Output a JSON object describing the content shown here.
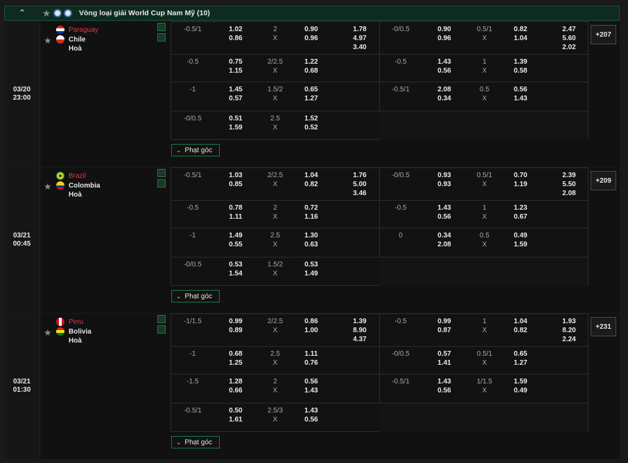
{
  "league": {
    "collapse_icon": "chevron-up-icon",
    "title": "Vòng loại giải World Cup Nam Mỹ (10)"
  },
  "colors": {
    "accent": "#1a7a4a",
    "home_team": "#e03a3a",
    "header_bg": "#0f2a1f"
  },
  "matches": [
    {
      "date": "03/20",
      "time": "23:00",
      "home": "Paraguay",
      "away": "Chile",
      "draw": "Hoà",
      "more": "+207",
      "corner": "Phạt góc",
      "rows": [
        {
          "l": {
            "h": "-0.5/1",
            "a": "1.02",
            "b": "0.86",
            "ou": "2",
            "x": "X",
            "o": "0.90",
            "u": "0.96",
            "m1": "1.78",
            "m2": "4.97",
            "m3": "3.40"
          },
          "r": {
            "h": "-0/0.5",
            "a": "0.90",
            "b": "0.96",
            "ou": "0.5/1",
            "x": "X",
            "o": "0.82",
            "u": "1.04",
            "m1": "2.47",
            "m2": "5.60",
            "m3": "2.02"
          }
        },
        {
          "l": {
            "h": "-0.5",
            "a": "0.75",
            "b": "1.15",
            "ou": "2/2.5",
            "x": "X",
            "o": "1.22",
            "u": "0.68"
          },
          "r": {
            "h": "-0.5",
            "a": "1.43",
            "b": "0.56",
            "ou": "1",
            "x": "X",
            "o": "1.39",
            "u": "0.58"
          }
        },
        {
          "l": {
            "h": "-1",
            "a": "1.45",
            "b": "0.57",
            "ou": "1.5/2",
            "x": "X",
            "o": "0.65",
            "u": "1.27"
          },
          "r": {
            "h": "-0.5/1",
            "a": "2.08",
            "b": "0.34",
            "ou": "0.5",
            "x": "X",
            "o": "0.56",
            "u": "1.43"
          }
        },
        {
          "l": {
            "h": "-0/0.5",
            "a": "0.51",
            "b": "1.59",
            "ou": "2.5",
            "x": "X",
            "o": "1.52",
            "u": "0.52"
          }
        }
      ]
    },
    {
      "date": "03/21",
      "time": "00:45",
      "home": "Brazil",
      "away": "Colombia",
      "draw": "Hoà",
      "more": "+209",
      "corner": "Phạt góc",
      "rows": [
        {
          "l": {
            "h": "-0.5/1",
            "a": "1.03",
            "b": "0.85",
            "ou": "2/2.5",
            "x": "X",
            "o": "1.04",
            "u": "0.82",
            "m1": "1.76",
            "m2": "5.00",
            "m3": "3.46"
          },
          "r": {
            "h": "-0/0.5",
            "a": "0.93",
            "b": "0.93",
            "ou": "0.5/1",
            "x": "X",
            "o": "0.70",
            "u": "1.19",
            "m1": "2.39",
            "m2": "5.50",
            "m3": "2.08"
          }
        },
        {
          "l": {
            "h": "-0.5",
            "a": "0.78",
            "b": "1.11",
            "ou": "2",
            "x": "X",
            "o": "0.72",
            "u": "1.16"
          },
          "r": {
            "h": "-0.5",
            "a": "1.43",
            "b": "0.56",
            "ou": "1",
            "x": "X",
            "o": "1.23",
            "u": "0.67"
          }
        },
        {
          "l": {
            "h": "-1",
            "a": "1.49",
            "b": "0.55",
            "ou": "2.5",
            "x": "X",
            "o": "1.30",
            "u": "0.63"
          },
          "r": {
            "h": "0",
            "a": "0.34",
            "b": "2.08",
            "ou": "0.5",
            "x": "X",
            "o": "0.49",
            "u": "1.59"
          }
        },
        {
          "l": {
            "h": "-0/0.5",
            "a": "0.53",
            "b": "1.54",
            "ou": "1.5/2",
            "x": "X",
            "o": "0.53",
            "u": "1.49"
          }
        }
      ]
    },
    {
      "date": "03/21",
      "time": "01:30",
      "home": "Peru",
      "away": "Bolivia",
      "draw": "Hoà",
      "more": "+231",
      "corner": "Phạt góc",
      "rows": [
        {
          "l": {
            "h": "-1/1.5",
            "a": "0.99",
            "b": "0.89",
            "ou": "2/2.5",
            "x": "X",
            "o": "0.86",
            "u": "1.00",
            "m1": "1.39",
            "m2": "8.90",
            "m3": "4.37"
          },
          "r": {
            "h": "-0.5",
            "a": "0.99",
            "b": "0.87",
            "ou": "1",
            "x": "X",
            "o": "1.04",
            "u": "0.82",
            "m1": "1.93",
            "m2": "8.20",
            "m3": "2.24"
          }
        },
        {
          "l": {
            "h": "-1",
            "a": "0.68",
            "b": "1.25",
            "ou": "2.5",
            "x": "X",
            "o": "1.11",
            "u": "0.76"
          },
          "r": {
            "h": "-0/0.5",
            "a": "0.57",
            "b": "1.41",
            "ou": "0.5/1",
            "x": "X",
            "o": "0.65",
            "u": "1.27"
          }
        },
        {
          "l": {
            "h": "-1.5",
            "a": "1.28",
            "b": "0.66",
            "ou": "2",
            "x": "X",
            "o": "0.56",
            "u": "1.43"
          },
          "r": {
            "h": "-0.5/1",
            "a": "1.43",
            "b": "0.56",
            "ou": "1/1.5",
            "x": "X",
            "o": "1.59",
            "u": "0.49"
          }
        },
        {
          "l": {
            "h": "-0.5/1",
            "a": "0.50",
            "b": "1.61",
            "ou": "2.5/3",
            "x": "X",
            "o": "1.43",
            "u": "0.56"
          }
        }
      ]
    }
  ]
}
